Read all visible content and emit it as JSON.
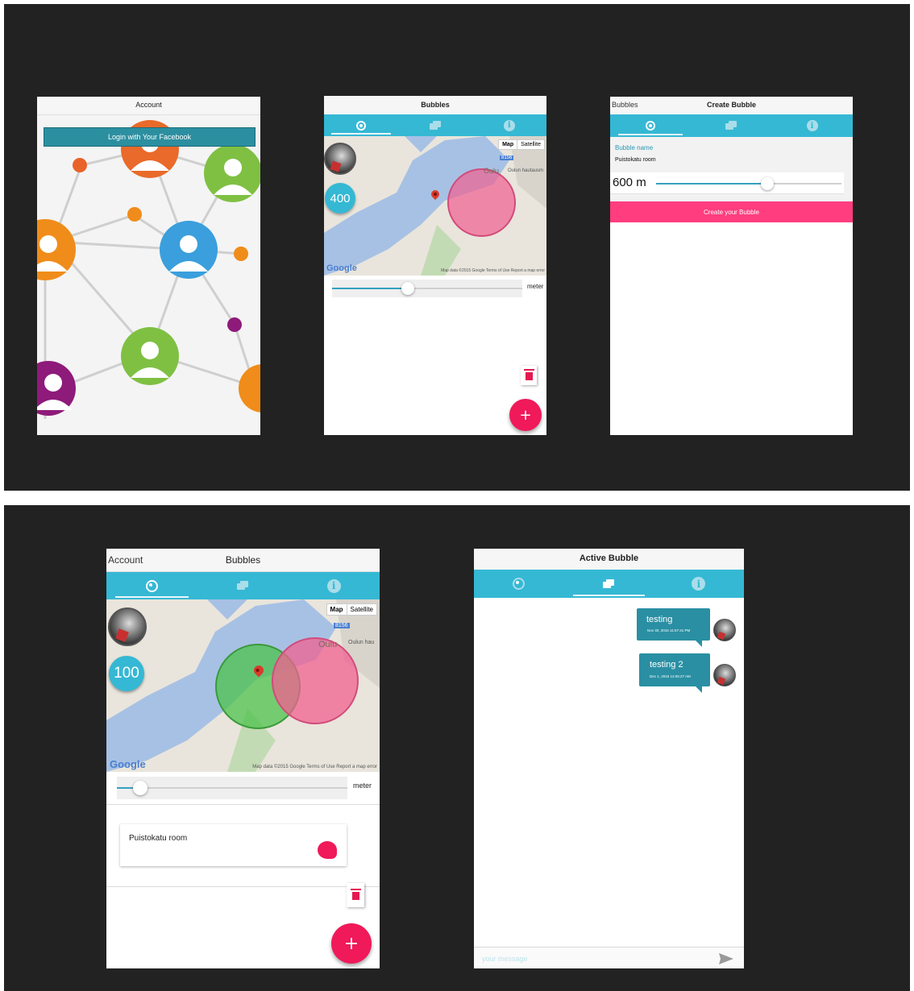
{
  "screen1": {
    "header_title": "Account",
    "login_button": "Login with Your Facebook"
  },
  "screen2": {
    "header_title": "Bubbles",
    "map": {
      "map_label": "Map",
      "satellite_label": "Satellite",
      "road_badge": "8156",
      "place_label": "Oulu",
      "place_label2": "Oulun hautausm",
      "footer": "Map data ©2015 Google   Terms of Use   Report a map error",
      "google": "Google"
    },
    "radius_count": "400",
    "slider_unit": "meter",
    "slider_value": 0.4,
    "fab_label": "+"
  },
  "screen3": {
    "back_label": "Bubbles",
    "header_title": "Create Bubble",
    "name_label": "Bubble name",
    "name_value": "Puistokatu room",
    "radius_value": "600 m",
    "slider_value": 0.6,
    "create_button": "Create your Bubble"
  },
  "screen4": {
    "back_label": "Account",
    "header_title": "Bubbles",
    "map": {
      "map_label": "Map",
      "satellite_label": "Satellite",
      "road_badge": "8156",
      "place_label": "Oulu",
      "place_label2": "Oulun hau",
      "footer": "Map data ©2015 Google   Terms of Use   Report a map error",
      "google": "Google"
    },
    "radius_count": "100",
    "slider_unit": "meter",
    "slider_value": 0.1,
    "room_card_title": "Puistokatu room",
    "fab_label": "+"
  },
  "screen5": {
    "header_title": "Active Bubble",
    "messages": [
      {
        "text": "testing",
        "time": "Nov 30, 2015 11:57:41 PM"
      },
      {
        "text": "testing 2",
        "time": "Dec 1, 2015 12:05:27 AM"
      }
    ],
    "input_placeholder": "your message"
  },
  "colors": {
    "accent": "#35b8d4",
    "create_button": "#ff3d7f",
    "fab": "#f0195a",
    "bubble_pink": "#f06090",
    "bubble_green": "#4cc24c",
    "message_bubble": "#2a8fa3",
    "background": "#222222"
  }
}
